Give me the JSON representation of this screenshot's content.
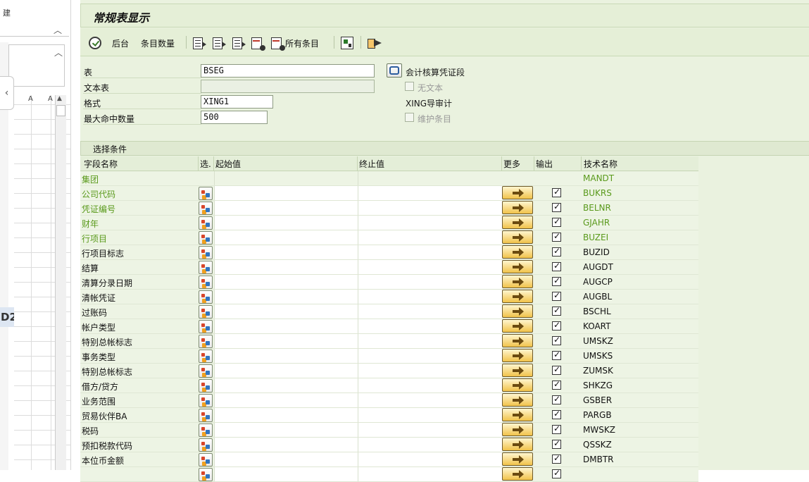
{
  "background_app": {
    "top_text": "建",
    "d2_text": "D2",
    "col_headers": [
      "A",
      "A"
    ]
  },
  "title": "常规表显示",
  "toolbar": {
    "background_label": "后台",
    "entry_count_label": "条目数量",
    "all_entries_label": "所有条目"
  },
  "form": {
    "table_label": "表",
    "table_value": "BSEG",
    "text_table_label": "文本表",
    "text_table_value": "",
    "layout_label": "格式",
    "layout_value": "XING1",
    "max_hits_label": "最大命中数量",
    "max_hits_value": "500",
    "doc_segment_button": "会计核算凭证段",
    "no_text_label": "无文本",
    "layout_desc": "XING导审计",
    "maintain_entries_label": "维护条目"
  },
  "selection": {
    "section_title": "选择条件",
    "headers": {
      "field_name": "字段名称",
      "sel": "选.",
      "from": "起始值",
      "to": "终止值",
      "more": "更多",
      "output": "输出",
      "tech_name": "技术名称"
    },
    "rows": [
      {
        "name": "集团",
        "tech": "MANDT",
        "key": true,
        "empty": true
      },
      {
        "name": "公司代码",
        "tech": "BUKRS",
        "key": true
      },
      {
        "name": "凭证编号",
        "tech": "BELNR",
        "key": true
      },
      {
        "name": "财年",
        "tech": "GJAHR",
        "key": true
      },
      {
        "name": "行项目",
        "tech": "BUZEI",
        "key": true
      },
      {
        "name": "行项目标志",
        "tech": "BUZID"
      },
      {
        "name": "结算",
        "tech": "AUGDT"
      },
      {
        "name": "清算分录日期",
        "tech": "AUGCP"
      },
      {
        "name": "清帐凭证",
        "tech": "AUGBL"
      },
      {
        "name": "过账码",
        "tech": "BSCHL"
      },
      {
        "name": "帐户类型",
        "tech": "KOART"
      },
      {
        "name": "特别总帐标志",
        "tech": "UMSKZ"
      },
      {
        "name": "事务类型",
        "tech": "UMSKS"
      },
      {
        "name": "特别总帐标志",
        "tech": "ZUMSK"
      },
      {
        "name": "借方/贷方",
        "tech": "SHKZG"
      },
      {
        "name": "业务范围",
        "tech": "GSBER"
      },
      {
        "name": "贸易伙伴BA",
        "tech": "PARGB"
      },
      {
        "name": "税码",
        "tech": "MWSKZ"
      },
      {
        "name": "预扣税款代码",
        "tech": "QSSKZ"
      },
      {
        "name": "本位币金额",
        "tech": "DMBTR"
      },
      {
        "name": "",
        "tech": ""
      }
    ]
  }
}
